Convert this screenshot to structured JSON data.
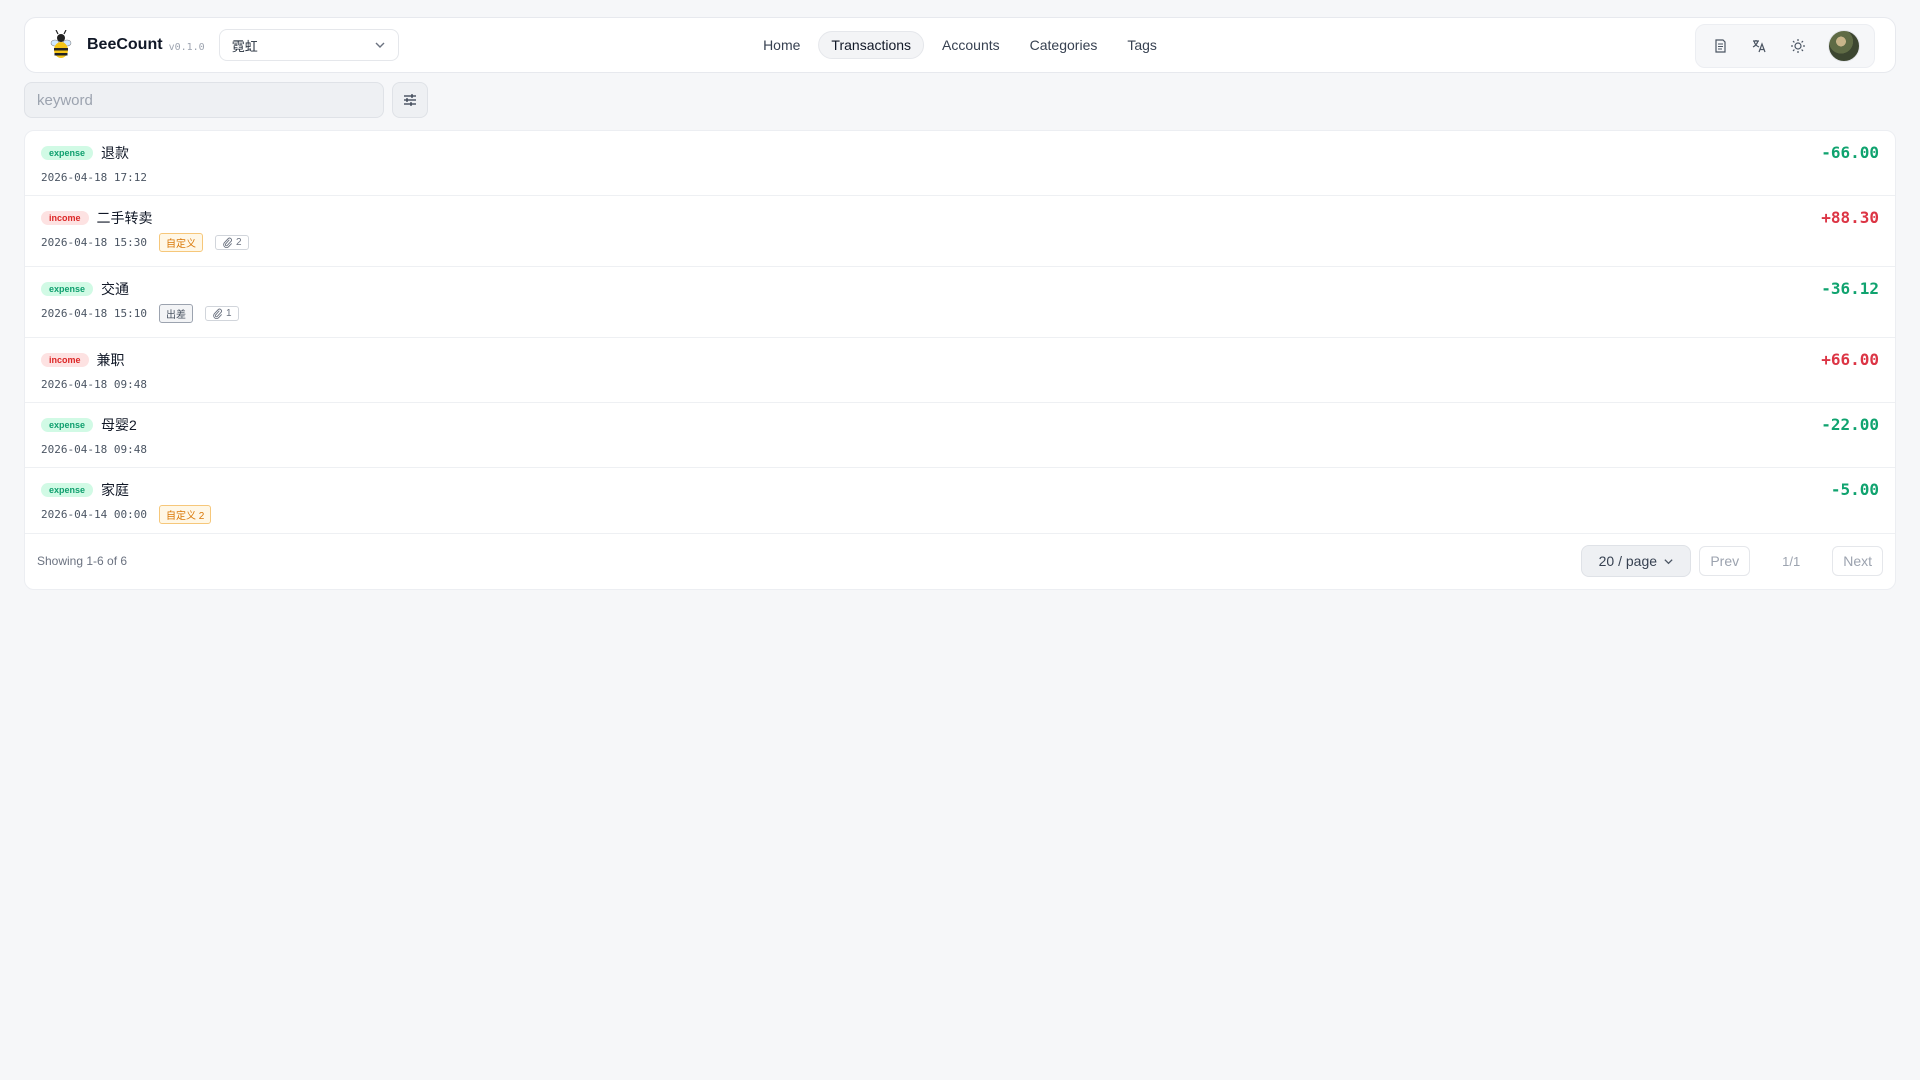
{
  "header": {
    "brand": "BeeCount",
    "version": "v0.1.0",
    "ledger": "霓虹",
    "nav": [
      {
        "label": "Home",
        "active": false
      },
      {
        "label": "Transactions",
        "active": true
      },
      {
        "label": "Accounts",
        "active": false
      },
      {
        "label": "Categories",
        "active": false
      },
      {
        "label": "Tags",
        "active": false
      }
    ],
    "tools": [
      "document-icon",
      "translate-icon",
      "sun-icon",
      "avatar"
    ]
  },
  "search": {
    "placeholder": "keyword",
    "value": ""
  },
  "transactions": [
    {
      "type": "expense",
      "title": "退款",
      "date": "2026-04-18 17:12",
      "tags": [],
      "attachments": null,
      "amount": "-66.00"
    },
    {
      "type": "income",
      "title": "二手转卖",
      "date": "2026-04-18 15:30",
      "tags": [
        {
          "label": "自定义",
          "color": "orange"
        }
      ],
      "attachments": "2",
      "amount": "+88.30"
    },
    {
      "type": "expense",
      "title": "交通",
      "date": "2026-04-18 15:10",
      "tags": [
        {
          "label": "出差",
          "color": "gray"
        }
      ],
      "attachments": "1",
      "amount": "-36.12"
    },
    {
      "type": "income",
      "title": "兼职",
      "date": "2026-04-18 09:48",
      "tags": [],
      "attachments": null,
      "amount": "+66.00"
    },
    {
      "type": "expense",
      "title": "母婴2",
      "date": "2026-04-18 09:48",
      "tags": [],
      "attachments": null,
      "amount": "-22.00"
    },
    {
      "type": "expense",
      "title": "家庭",
      "date": "2026-04-14 00:00",
      "tags": [
        {
          "label": "自定义 2",
          "color": "orange"
        }
      ],
      "attachments": null,
      "amount": "-5.00"
    }
  ],
  "footer": {
    "showing": "Showing 1-6 of 6",
    "page_size": "20 / page",
    "prev": "Prev",
    "page": "1/1",
    "next": "Next"
  },
  "colors": {
    "expense": "#10a36f",
    "income": "#dc3545",
    "background": "#f6f7f9"
  }
}
